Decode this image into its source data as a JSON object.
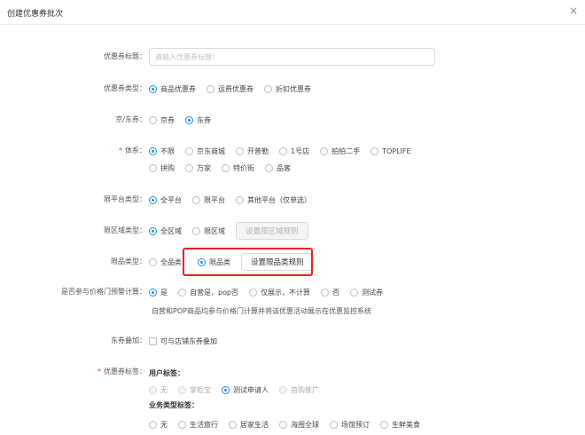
{
  "dialog": {
    "title": "创建优惠券批次",
    "close": "×"
  },
  "form": {
    "coupon_title": {
      "label": "优惠券标题",
      "placeholder": "请输入优惠券标题！",
      "value": ""
    },
    "coupon_type": {
      "label": "优惠券类型",
      "options": [
        "商品优惠券",
        "运费优惠券",
        "折扣优惠券"
      ],
      "selected": 0
    },
    "jing_dong": {
      "label": "京/东券",
      "options": [
        "京券",
        "东券"
      ],
      "selected": 1
    },
    "system": {
      "label": "体系",
      "required": "*",
      "options_row1": [
        "不限",
        "京东商城",
        "开普勒",
        "1号店",
        "拍拍二手",
        "TOPLIFE"
      ],
      "options_row2": [
        "拼购",
        "万家",
        "特价街",
        "品客"
      ],
      "selected": "不限"
    },
    "platform": {
      "label": "限平台类型",
      "options": [
        "全平台",
        "限平台",
        "其他平台（仅单选）"
      ],
      "selected": 0
    },
    "region": {
      "label": "限区域类型",
      "options": [
        "全区域",
        "限区域"
      ],
      "selected": 0,
      "button": "设置限区域规则"
    },
    "category": {
      "label": "限品类型",
      "options": [
        "全品类",
        "限品类"
      ],
      "selected": 1,
      "button": "设置限品类规则"
    },
    "price_calc": {
      "label": "是否参与价格门预警计算",
      "options": [
        "是",
        "自营是，pop否",
        "仅展示，不计算",
        "否",
        "测试券"
      ],
      "selected": 0,
      "note": "自营和POP商品均参与价格门计算并将该优惠活动展示在优惠监控系统"
    },
    "stacking": {
      "label": "东券叠加",
      "checkbox": "可与店铺东券叠加"
    },
    "coupon_tags": {
      "label": "优惠券标签",
      "required": "*",
      "user_tags_title": "用户标签：",
      "user_tags": [
        "无",
        "掌柜宝",
        "测试申请人",
        "首购推广"
      ],
      "user_selected": 2,
      "biz_tags_title": "业务类型标签：",
      "biz_tags": [
        "无",
        "生活旅行",
        "居家生活",
        "海囤全球",
        "场馆预订",
        "生鲜美食"
      ]
    },
    "colon": "："
  },
  "colors": {
    "accent": "#1890ff",
    "highlight": "#e8231c"
  }
}
